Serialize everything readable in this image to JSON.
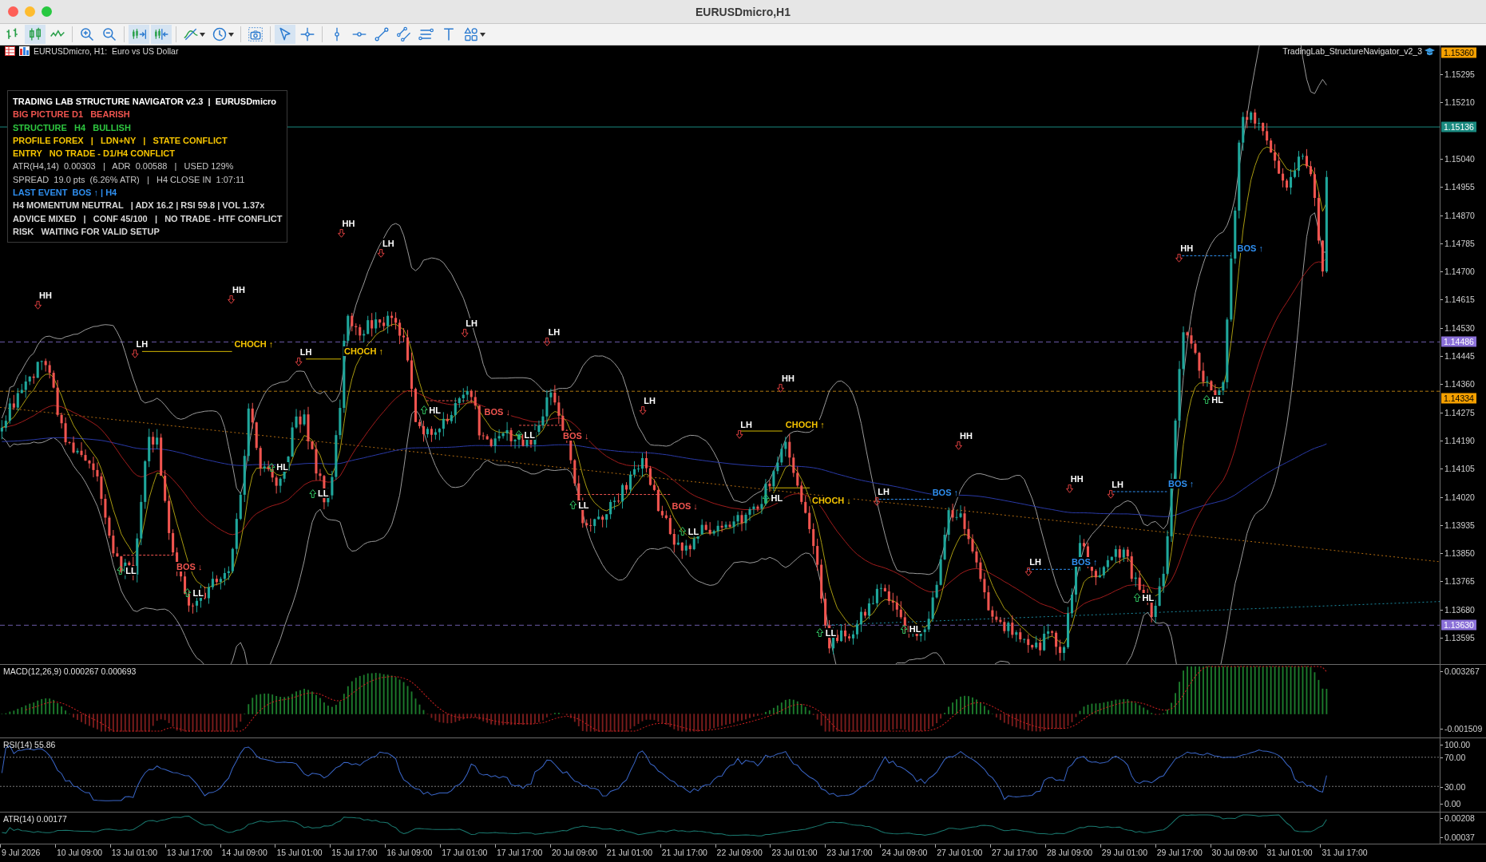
{
  "window": {
    "title": "EURUSDmicro,H1"
  },
  "toolbar": [
    {
      "kind": "bars",
      "selected": false
    },
    {
      "kind": "candles",
      "selected": true
    },
    {
      "kind": "line",
      "selected": false
    },
    {
      "kind": "zoom-in",
      "selected": false
    },
    {
      "kind": "zoom-out",
      "selected": false
    },
    {
      "kind": "chart-shift",
      "selected": true
    },
    {
      "kind": "autoscroll",
      "selected": true
    },
    {
      "kind": "indicators",
      "selected": false
    },
    {
      "kind": "periods",
      "selected": false
    },
    {
      "kind": "screenshot",
      "selected": false
    },
    {
      "kind": "cursor",
      "selected": true
    },
    {
      "kind": "crosshair",
      "selected": false
    },
    {
      "kind": "vline",
      "selected": false
    },
    {
      "kind": "hline",
      "selected": false
    },
    {
      "kind": "trend",
      "selected": false
    },
    {
      "kind": "channel",
      "selected": false
    },
    {
      "kind": "fibo",
      "selected": false
    },
    {
      "kind": "text",
      "selected": false
    },
    {
      "kind": "shapes",
      "selected": false
    }
  ],
  "chart": {
    "symbol": "EURUSDmicro, H1:  Euro vs US Dollar",
    "indicator": "TradingLab_StructureNavigator_v2_3",
    "panel": [
      {
        "text": "TRADING LAB STRUCTURE NAVIGATOR v2.3  |  EURUSDmicro",
        "kind": "title",
        "color": "#ffffff"
      },
      {
        "text": "BIG PICTURE D1   BEARISH",
        "kind": "bold",
        "color": "#f0544f"
      },
      {
        "text": "STRUCTURE   H4   BULLISH",
        "kind": "bold",
        "color": "#2ec840"
      },
      {
        "text": "PROFILE FOREX   |   LDN+NY   |   STATE CONFLICT",
        "kind": "bold",
        "color": "#f5c400"
      },
      {
        "text": "ENTRY   NO TRADE - D1/H4 CONFLICT",
        "kind": "bold",
        "color": "#f5c400"
      },
      {
        "text": "ATR(H4,14)  0.00303   |   ADR  0.00588   |   USED 129%",
        "kind": "plain",
        "color": "#c8c8c8"
      },
      {
        "text": "SPREAD  19.0 pts  (6.26% ATR)   |   H4 CLOSE IN  1:07:11",
        "kind": "plain",
        "color": "#c8c8c8"
      },
      {
        "text": "LAST EVENT  BOS ↑ | H4",
        "kind": "bold",
        "color": "#2f8ff0"
      },
      {
        "text": "H4 MOMENTUM NEUTRAL   | ADX 16.2 | RSI 59.8 | VOL 1.37x",
        "kind": "bold",
        "color": "#d8d8d8"
      },
      {
        "text": "ADVICE MIXED   |   CONF 45/100   |   NO TRADE - HTF CONFLICT",
        "kind": "bold",
        "color": "#d8d8d8"
      },
      {
        "text": "RISK   WAITING FOR VALID SETUP",
        "kind": "bold",
        "color": "#d8d8d8"
      }
    ],
    "markers": [
      {
        "text": "HH",
        "kind": "high",
        "color": "#ffffff"
      },
      {
        "text": "LH",
        "kind": "high",
        "color": "#ffffff"
      },
      {
        "text": "CHOCH ↑",
        "kind": "event",
        "color": "#f5c400"
      },
      {
        "text": "HH",
        "kind": "high",
        "color": "#ffffff"
      },
      {
        "text": "LH",
        "kind": "high",
        "color": "#ffffff"
      },
      {
        "text": "CHOCH ↑",
        "kind": "event",
        "color": "#f5c400"
      },
      {
        "text": "HH",
        "kind": "high",
        "color": "#ffffff"
      },
      {
        "text": "LH",
        "kind": "high",
        "color": "#ffffff"
      },
      {
        "text": "LH",
        "kind": "high",
        "color": "#ffffff"
      },
      {
        "text": "LH",
        "kind": "high",
        "color": "#ffffff"
      },
      {
        "text": "HL",
        "kind": "low",
        "color": "#ffffff"
      },
      {
        "text": "BOS ↓",
        "kind": "event",
        "color": "#f0544f"
      },
      {
        "text": "LL",
        "kind": "low",
        "color": "#ffffff"
      },
      {
        "text": "BOS ↓",
        "kind": "event",
        "color": "#f0544f"
      },
      {
        "text": "HL",
        "kind": "low",
        "color": "#ffffff"
      },
      {
        "text": "LL",
        "kind": "low",
        "color": "#ffffff"
      },
      {
        "text": "LL",
        "kind": "low",
        "color": "#ffffff"
      },
      {
        "text": "BOS ↓",
        "kind": "event",
        "color": "#f0544f"
      },
      {
        "text": "LL",
        "kind": "low",
        "color": "#ffffff"
      },
      {
        "text": "LH",
        "kind": "high",
        "color": "#ffffff"
      },
      {
        "text": "LL",
        "kind": "low",
        "color": "#ffffff"
      },
      {
        "text": "BOS ↓",
        "kind": "event",
        "color": "#f0544f"
      },
      {
        "text": "LL",
        "kind": "low",
        "color": "#ffffff"
      },
      {
        "text": "LH",
        "kind": "high",
        "color": "#ffffff"
      },
      {
        "text": "HH",
        "kind": "high",
        "color": "#ffffff"
      },
      {
        "text": "CHOCH ↑",
        "kind": "event",
        "color": "#f5c400"
      },
      {
        "text": "HL",
        "kind": "low",
        "color": "#ffffff"
      },
      {
        "text": "CHOCH ↓",
        "kind": "event",
        "color": "#f5c400"
      },
      {
        "text": "LH",
        "kind": "high",
        "color": "#ffffff"
      },
      {
        "text": "BOS ↑",
        "kind": "event",
        "color": "#2f8ff0"
      },
      {
        "text": "HH",
        "kind": "high",
        "color": "#ffffff"
      },
      {
        "text": "LL",
        "kind": "low",
        "color": "#ffffff"
      },
      {
        "text": "HL",
        "kind": "low",
        "color": "#ffffff"
      },
      {
        "text": "HH",
        "kind": "high",
        "color": "#ffffff"
      },
      {
        "text": "LH",
        "kind": "high",
        "color": "#ffffff"
      },
      {
        "text": "BOS ↑",
        "kind": "event",
        "color": "#2f8ff0"
      },
      {
        "text": "LH",
        "kind": "high",
        "color": "#ffffff"
      },
      {
        "text": "BOS ↑",
        "kind": "event",
        "color": "#2f8ff0"
      },
      {
        "text": "HL",
        "kind": "low",
        "color": "#ffffff"
      },
      {
        "text": "HH",
        "kind": "high",
        "color": "#ffffff"
      },
      {
        "text": "BOS ↑",
        "kind": "event",
        "color": "#2f8ff0"
      },
      {
        "text": "HL",
        "kind": "low",
        "color": "#ffffff"
      }
    ],
    "price_axis": {
      "ticks": [
        "1.15295",
        "1.15210",
        "1.15040",
        "1.14955",
        "1.14870",
        "1.14785",
        "1.14700",
        "1.14615",
        "1.14530",
        "1.14445",
        "1.14360",
        "1.14275",
        "1.14190",
        "1.14105",
        "1.14020",
        "1.13935",
        "1.13850",
        "1.13765",
        "1.13680",
        "1.13595"
      ],
      "tags": [
        {
          "text": "1.15360",
          "color": "#f5a000"
        },
        {
          "text": "1.15136",
          "color": "#1a8a80"
        },
        {
          "text": "1.14486",
          "color": "#8a70d8"
        },
        {
          "text": "1.14334",
          "color": "#f5a000"
        },
        {
          "text": "1.13630",
          "color": "#8a70d8"
        }
      ]
    }
  },
  "subwindows": [
    {
      "kind": "macd",
      "label": "MACD(12,26,9) 0.000267 0.000693",
      "scale": [
        "0.003267",
        "-0.001509"
      ]
    },
    {
      "kind": "rsi",
      "label": "RSI(14) 55.86",
      "scale": [
        "100.00",
        "70.00",
        "30.00",
        "0.00"
      ]
    },
    {
      "kind": "atr",
      "label": "ATR(14) 0.00177",
      "scale": [
        "0.00208",
        "0.00037"
      ]
    }
  ],
  "time_axis": [
    "9 Jul 2026",
    "10 Jul 09:00",
    "13 Jul 01:00",
    "13 Jul 17:00",
    "14 Jul 09:00",
    "15 Jul 01:00",
    "15 Jul 17:00",
    "16 Jul 09:00",
    "17 Jul 01:00",
    "17 Jul 17:00",
    "20 Jul 09:00",
    "21 Jul 01:00",
    "21 Jul 17:00",
    "22 Jul 09:00",
    "23 Jul 01:00",
    "23 Jul 17:00",
    "24 Jul 09:00",
    "27 Jul 01:00",
    "27 Jul 17:00",
    "28 Jul 09:00",
    "29 Jul 01:00",
    "29 Jul 17:00",
    "30 Jul 09:00",
    "31 Jul 01:00",
    "31 Jul 17:00"
  ]
}
